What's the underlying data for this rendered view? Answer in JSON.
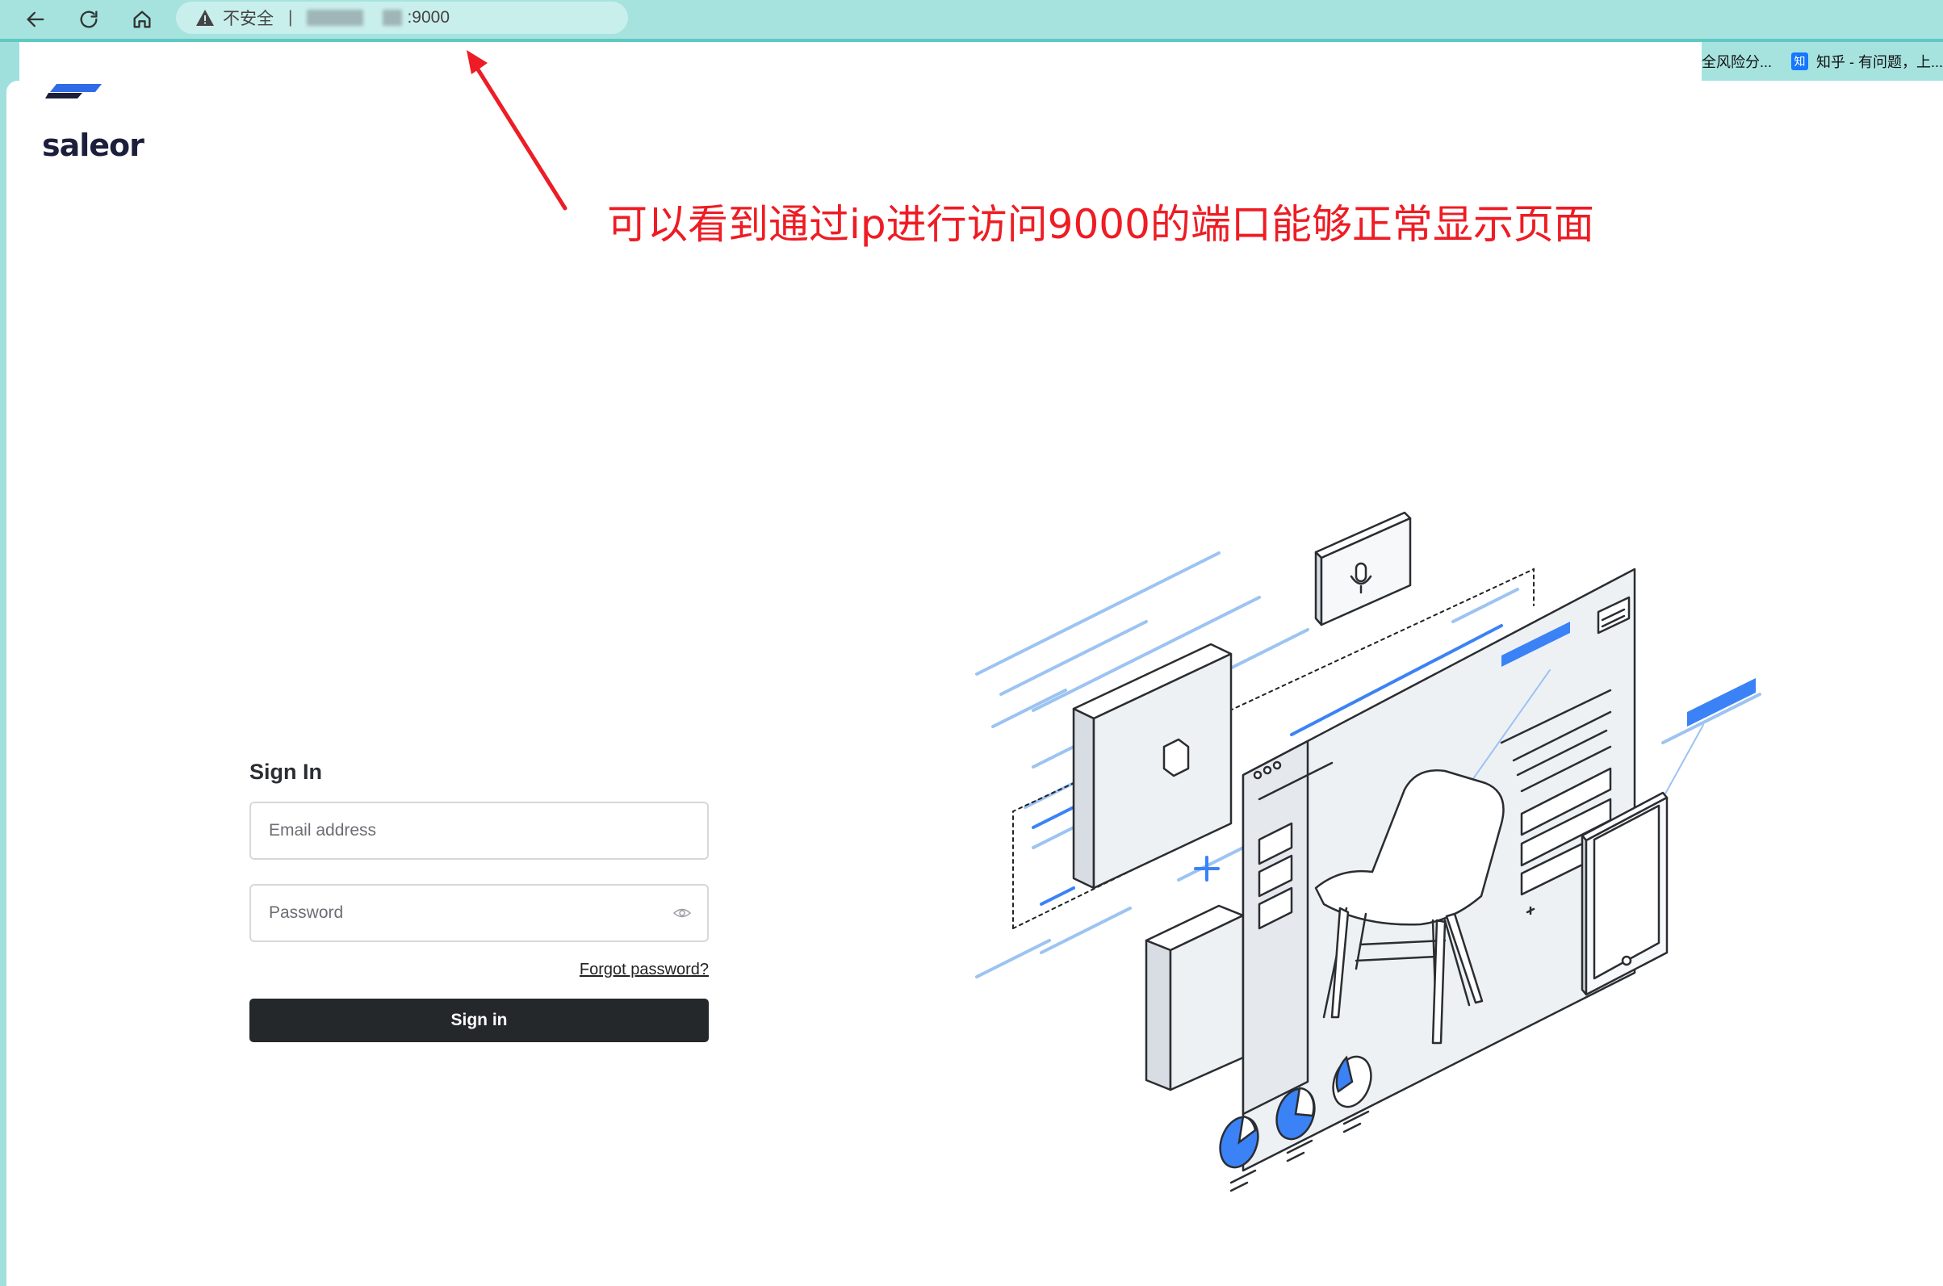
{
  "browser": {
    "security_label": "不安全",
    "separator": "|",
    "url_port": ":9000",
    "bookmarks": [
      {
        "label": "全风险分..."
      },
      {
        "icon_text": "知",
        "label": "知乎 - 有问题，上..."
      }
    ]
  },
  "annotation": {
    "text": "可以看到通过ip进行访问9000的端口能够正常显示页面",
    "color": "#ee1c24"
  },
  "app": {
    "logo_text": "saleor"
  },
  "signin": {
    "title": "Sign In",
    "email_placeholder": "Email address",
    "password_placeholder": "Password",
    "forgot_label": "Forgot password?",
    "button_label": "Sign in"
  },
  "colors": {
    "browser_chrome": "#a6e3df",
    "button_bg": "#25282b",
    "illustration_accent": "#3b82f6",
    "logo_mark": "#2f6be6"
  }
}
